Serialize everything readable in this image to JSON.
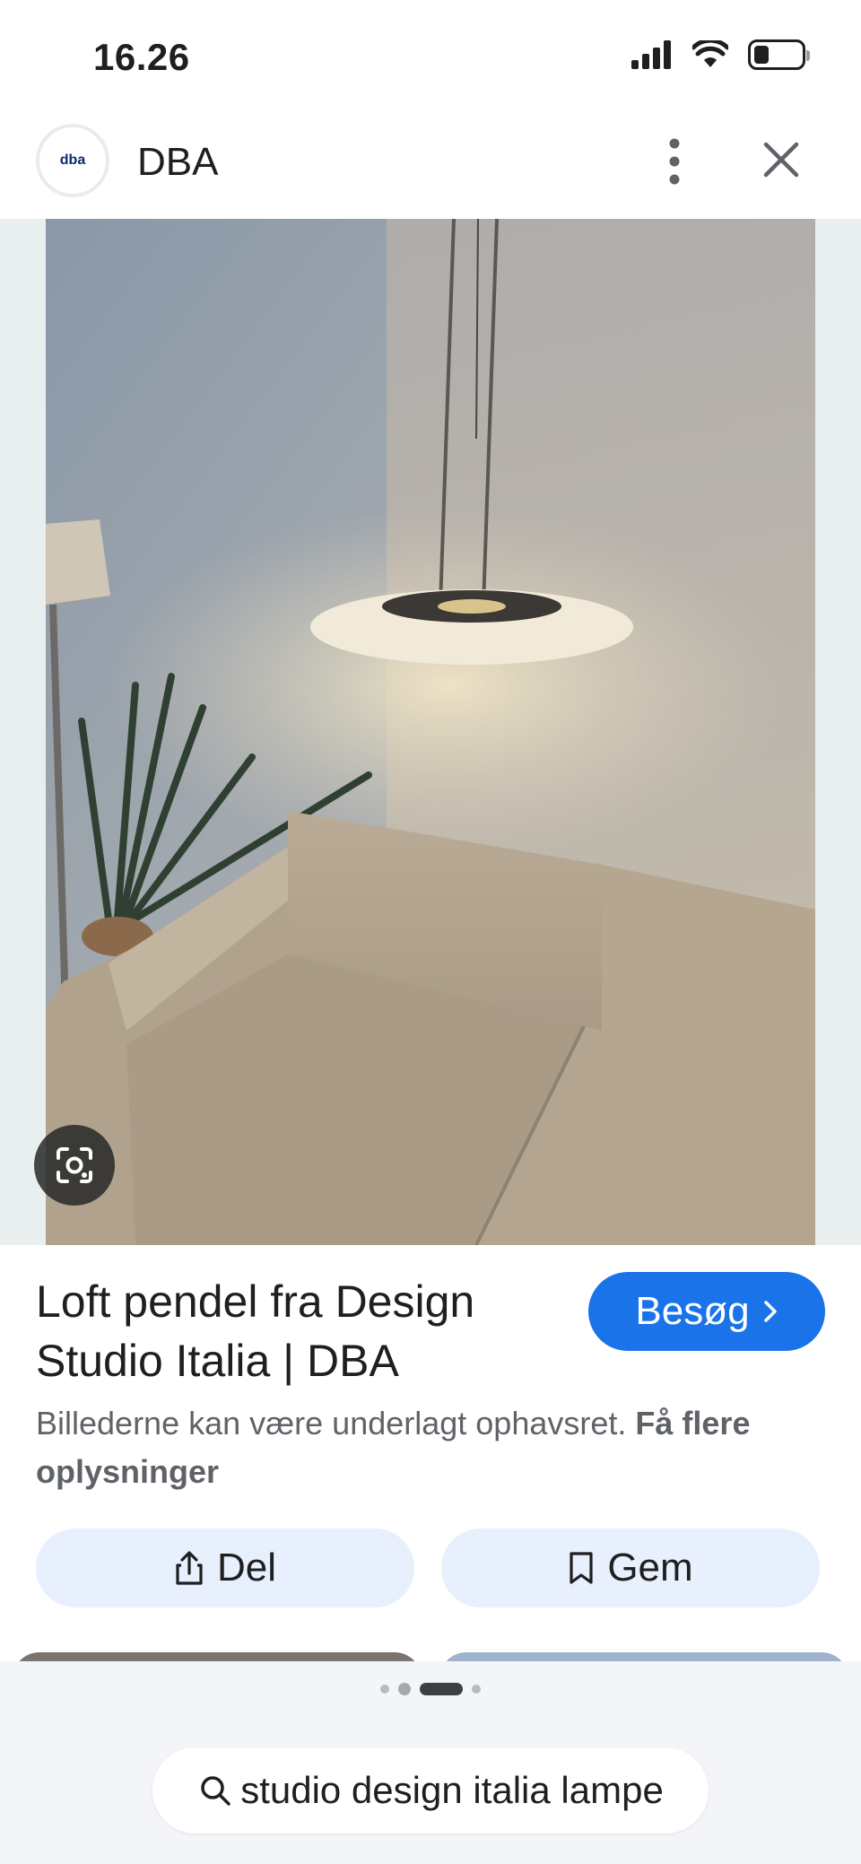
{
  "status_bar": {
    "time": "16.26",
    "icons": [
      "cellular-signal-icon",
      "wifi-icon",
      "battery-icon"
    ]
  },
  "header": {
    "logo_text": "dba",
    "site_name": "DBA",
    "icons": [
      "more-vertical-icon",
      "close-icon"
    ]
  },
  "image": {
    "lens_icon": "google-lens-icon"
  },
  "result": {
    "title": "Loft pendel fra Design Studio Italia | DBA",
    "visit_label": "Besøg",
    "visit_icon": "chevron-right-icon",
    "notice_text": "Billederne kan være underlagt ophavsret.",
    "notice_link": "Få flere oplysninger"
  },
  "actions": {
    "share_label": "Del",
    "share_icon": "share-icon",
    "save_label": "Gem",
    "save_icon": "bookmark-icon"
  },
  "pager": {
    "active_index": 2,
    "count": 4
  },
  "search": {
    "query": "studio design italia lampe",
    "icon": "search-icon"
  },
  "colors": {
    "accent": "#1a73e8",
    "action_bg": "#e8effd",
    "text_secondary": "#5f6368"
  }
}
